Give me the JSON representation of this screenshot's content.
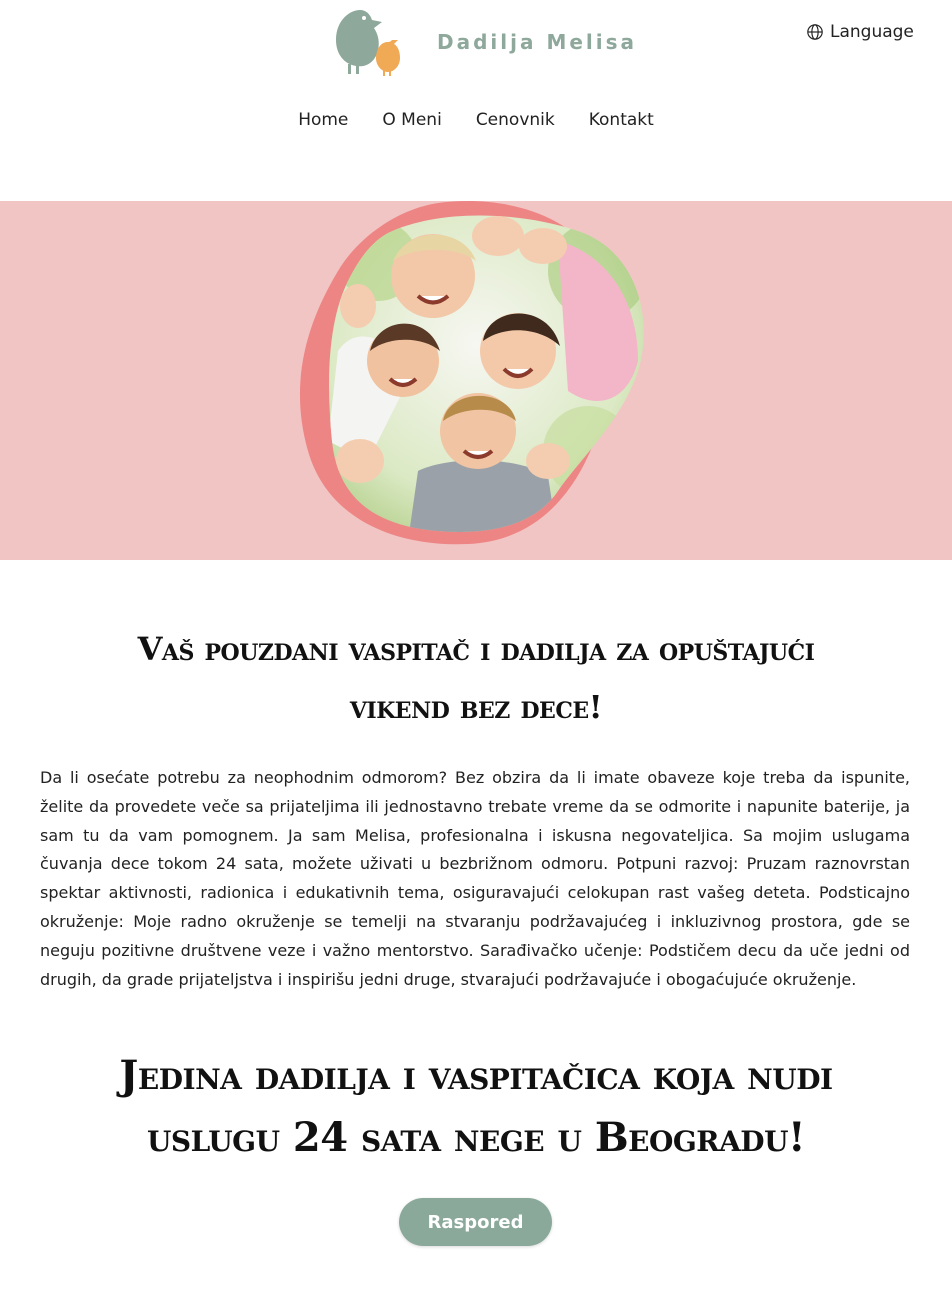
{
  "header": {
    "brand": "Dadilja Melisa",
    "language_label": "Language",
    "logo_icon": "bird-logo-icon",
    "language_icon": "globe-icon"
  },
  "nav": {
    "items": [
      {
        "label": "Home"
      },
      {
        "label": "O Meni"
      },
      {
        "label": "Cenovnik"
      },
      {
        "label": "Kontakt"
      }
    ]
  },
  "hero": {
    "image_subject": "children-in-circle-photo"
  },
  "main": {
    "headline_line1": "Vaš pouzdani vaspitač i dadilja za opuštajući",
    "headline_line2": "vikend bez dece!",
    "paragraph": "Da li osećate potrebu za neophodnim odmorom? Bez obzira da li imate obaveze koje treba da ispunite, želite da provedete veče sa prijateljima ili jednostavno trebate vreme da se odmorite i napunite baterije, ja sam tu da vam pomognem. Ja sam Melisa, profesionalna i iskusna negovateljica. Sa mojim uslugama čuvanja dece tokom 24 sata, možete uživati u bezbrižnom odmoru. Potpuni razvoj: Pruzam raznovrstan spektar aktivnosti, radionica i edukativnih tema, osiguravajući celokupan rast vašeg deteta. Podsticajno okruženje: Moje radno okruženje se temelji na stvaranju podržavajućeg i inkluzivnog prostora, gde se neguju pozitivne društvene veze i važno mentorstvo. Sarađivačko učenje: Podstičem decu da uče jedni od drugih, da grade prijateljstva i inspirišu jedni druge, stvarajući podržavajuće i obogaćujuće okruženje.",
    "headline2_line1": "Jedina dadilja i vaspitačica koja nudi",
    "headline2_line2": "uslugu 24 sata nege u Beogradu!",
    "button_label": "Raspored"
  },
  "colors": {
    "accent": "#8aa99b",
    "hero_bg": "#f1c5c4",
    "blob": "#ee8585",
    "logo_orange": "#f0a955"
  }
}
